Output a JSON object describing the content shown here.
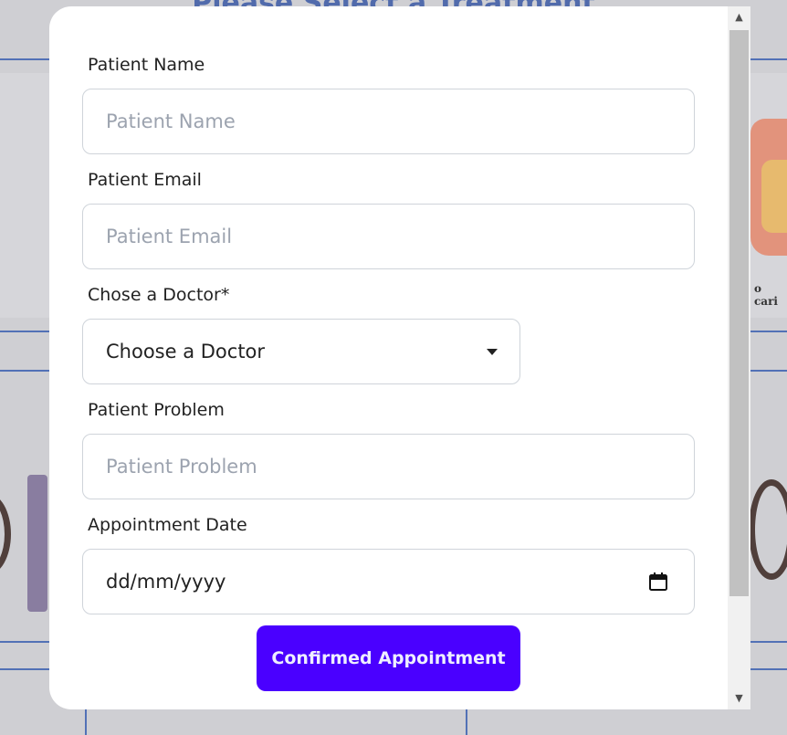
{
  "background": {
    "heading": "Please Select a Treatment",
    "card_snippet": "o cari"
  },
  "form": {
    "name": {
      "label": "Patient Name",
      "placeholder": "Patient Name"
    },
    "email": {
      "label": "Patient Email",
      "placeholder": "Patient Email"
    },
    "doctor": {
      "label": "Chose a Doctor*",
      "selected": "Choose a Doctor"
    },
    "problem": {
      "label": "Patient Problem",
      "placeholder": "Patient Problem"
    },
    "date": {
      "label": "Appointment Date",
      "value": "dd/mm/yyyy",
      "icon": "calendar-icon"
    },
    "submit_label": "Confirmed Appointment"
  },
  "scrollbar": {
    "up_icon": "scroll-up-arrow-icon",
    "down_icon": "scroll-down-arrow-icon"
  },
  "colors": {
    "accent": "#4a00ff",
    "border": "#cfd4da",
    "placeholder": "#9ca3af"
  }
}
